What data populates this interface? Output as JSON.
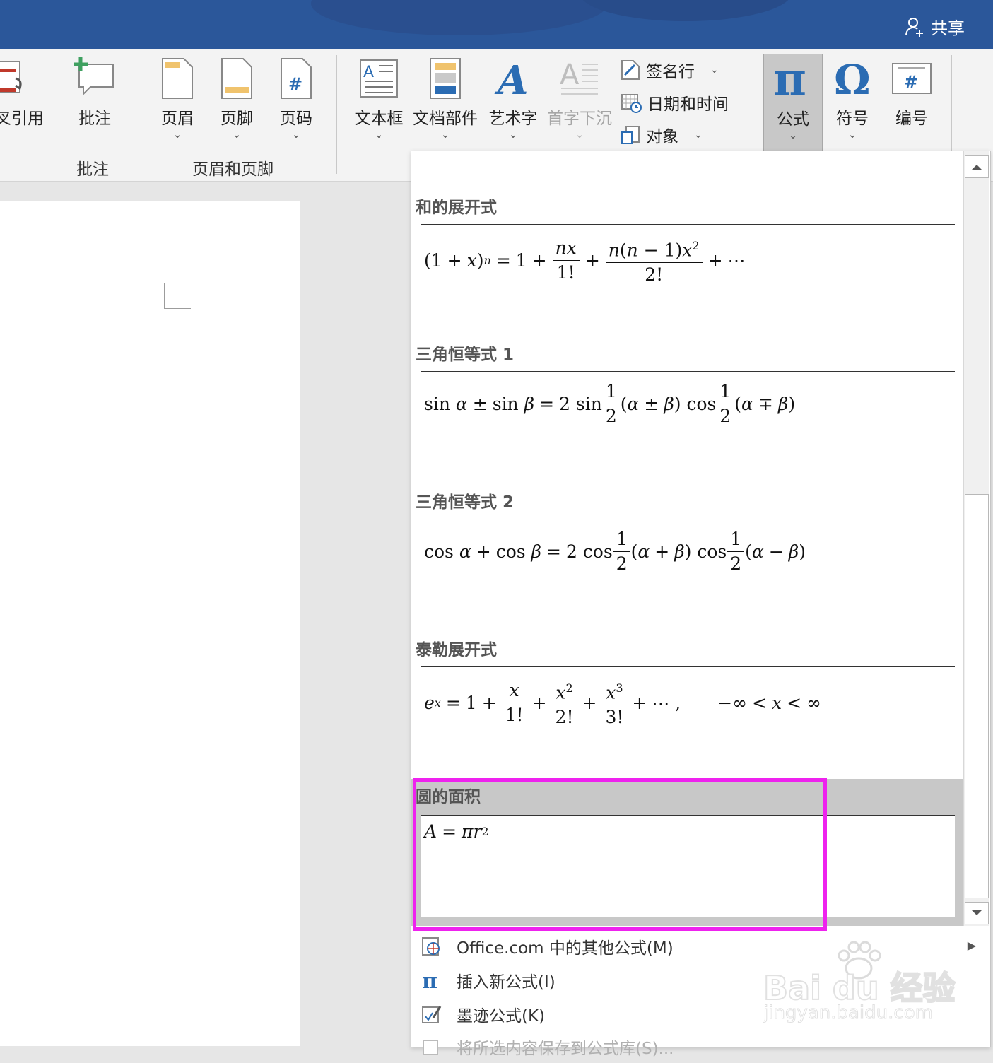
{
  "titlebar": {
    "share_label": "共享"
  },
  "ribbon": {
    "groups": {
      "comments": "批注",
      "header_footer": "页眉和页脚"
    },
    "buttons": {
      "cross_reference": "交叉引用",
      "comment": "批注",
      "header": "页眉",
      "footer": "页脚",
      "page_number": "页码",
      "text_box": "文本框",
      "quick_parts": "文档部件",
      "wordart": "艺术字",
      "drop_cap": "首字下沉",
      "signature_line": "签名行",
      "date_time": "日期和时间",
      "object": "对象",
      "equation": "公式",
      "symbol": "符号",
      "numbering": "编号"
    }
  },
  "gallery": {
    "equations": [
      {
        "title": "和的展开式",
        "formula": "(1 + x)^n = 1 + nx/1! + n(n−1)x²/2! + ⋯"
      },
      {
        "title": "三角恒等式 1",
        "formula": "sin α ± sin β = 2 sin ½(α ± β) cos ½(α ∓ β)"
      },
      {
        "title": "三角恒等式 2",
        "formula": "cos α + cos β = 2 cos ½(α + β) cos ½(α − β)"
      },
      {
        "title": "泰勒展开式",
        "formula": "e^x = 1 + x/1! + x²/2! + x³/3! + ⋯ , −∞ < x < ∞"
      },
      {
        "title": "圆的面积",
        "formula": "A = πr²",
        "selected": true
      }
    ],
    "menu": [
      {
        "label": "Office.com 中的其他公式(M)",
        "has_submenu": true,
        "enabled": true
      },
      {
        "label": "插入新公式(I)",
        "enabled": true
      },
      {
        "label": "墨迹公式(K)",
        "enabled": true
      },
      {
        "label": "将所选内容保存到公式库(S)...",
        "enabled": false
      }
    ]
  },
  "watermark": {
    "brand": "Bai du 经验",
    "url": "jingyan.baidu.com"
  },
  "colors": {
    "titlebar": "#2b579a",
    "highlight": "#ee22ee",
    "selected_bg": "#c8c8c8",
    "accent_blue": "#2b6cb3"
  }
}
